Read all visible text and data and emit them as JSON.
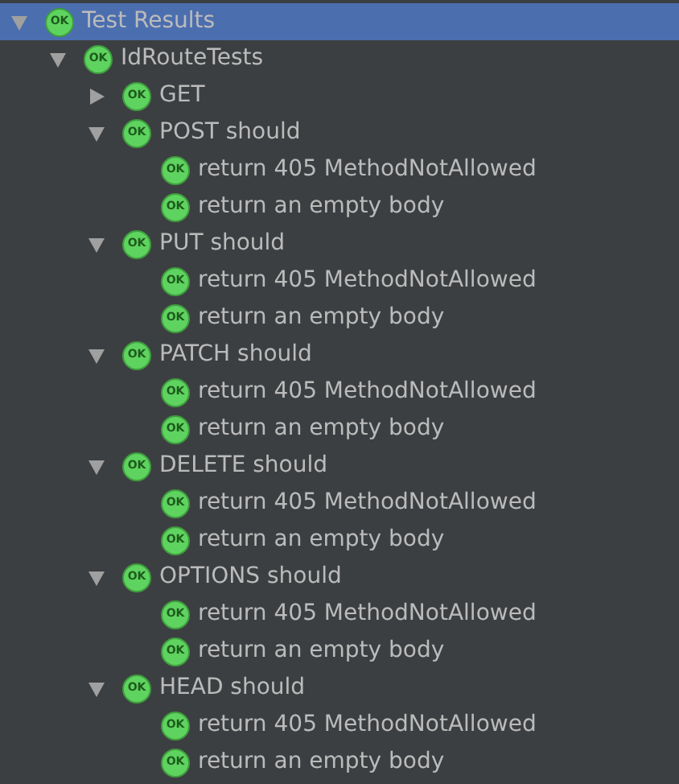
{
  "tree": [
    {
      "label": "Test Results",
      "badge": "OK",
      "selected": true,
      "expanded": true,
      "children": [
        {
          "label": "IdRouteTests",
          "badge": "OK",
          "selected": false,
          "expanded": true,
          "children": [
            {
              "label": "GET",
              "badge": "OK",
              "selected": false,
              "expanded": false
            },
            {
              "label": "POST should",
              "badge": "OK",
              "selected": false,
              "expanded": true,
              "children": [
                {
                  "label": "return 405 MethodNotAllowed",
                  "badge": "OK",
                  "selected": false
                },
                {
                  "label": "return an empty body",
                  "badge": "OK",
                  "selected": false
                }
              ]
            },
            {
              "label": "PUT should",
              "badge": "OK",
              "selected": false,
              "expanded": true,
              "children": [
                {
                  "label": "return 405 MethodNotAllowed",
                  "badge": "OK",
                  "selected": false
                },
                {
                  "label": "return an empty body",
                  "badge": "OK",
                  "selected": false
                }
              ]
            },
            {
              "label": "PATCH should",
              "badge": "OK",
              "selected": false,
              "expanded": true,
              "children": [
                {
                  "label": "return 405 MethodNotAllowed",
                  "badge": "OK",
                  "selected": false
                },
                {
                  "label": "return an empty body",
                  "badge": "OK",
                  "selected": false
                }
              ]
            },
            {
              "label": "DELETE should",
              "badge": "OK",
              "selected": false,
              "expanded": true,
              "children": [
                {
                  "label": "return 405 MethodNotAllowed",
                  "badge": "OK",
                  "selected": false
                },
                {
                  "label": "return an empty body",
                  "badge": "OK",
                  "selected": false
                }
              ]
            },
            {
              "label": "OPTIONS should",
              "badge": "OK",
              "selected": false,
              "expanded": true,
              "children": [
                {
                  "label": "return 405 MethodNotAllowed",
                  "badge": "OK",
                  "selected": false
                },
                {
                  "label": "return an empty body",
                  "badge": "OK",
                  "selected": false
                }
              ]
            },
            {
              "label": "HEAD should",
              "badge": "OK",
              "selected": false,
              "expanded": true,
              "children": [
                {
                  "label": "return 405 MethodNotAllowed",
                  "badge": "OK",
                  "selected": false
                },
                {
                  "label": "return an empty body",
                  "badge": "OK",
                  "selected": false
                }
              ]
            }
          ]
        }
      ]
    }
  ]
}
